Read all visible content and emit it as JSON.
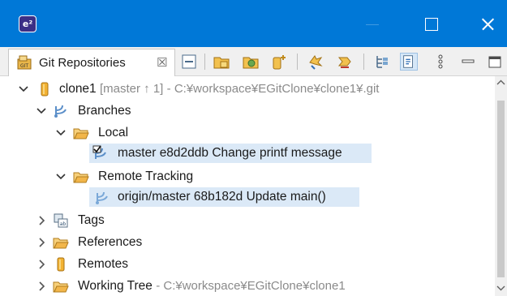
{
  "window": {
    "app_icon": "e²",
    "controls": [
      "minimize-icon",
      "maximize-icon",
      "close-icon"
    ]
  },
  "view": {
    "tab_label": "Git Repositories",
    "tab_close": "☒",
    "toolbar_icons": [
      "collapse-all-icon",
      "add-existing-repository-icon",
      "clone-repository-icon",
      "create-repository-icon",
      "fetch-icon",
      "push-icon",
      "hierarchical-branch-layout-icon",
      "link-with-selection-icon",
      "view-menu-icon",
      "minimize-view-icon",
      "maximize-view-icon"
    ]
  },
  "tree": {
    "repository": {
      "name": "clone1",
      "decoration": "[master ↑ 1]",
      "path": "- C:¥workspace¥EGitClone¥clone1¥.git"
    },
    "branches": {
      "label": "Branches",
      "local": {
        "label": "Local",
        "items": [
          {
            "name": "master",
            "commit": "e8d2ddb",
            "message": "Change printf message"
          }
        ]
      },
      "remote": {
        "label": "Remote Tracking",
        "items": [
          {
            "name": "origin/master",
            "commit": "68b182d",
            "message": "Update main()"
          }
        ]
      }
    },
    "tags": "Tags",
    "references": "References",
    "remotes": "Remotes",
    "working_tree": {
      "label": "Working Tree",
      "path": "- C:¥workspace¥EGitClone¥clone1"
    }
  },
  "colors": {
    "titlebar": "#0078d7",
    "selection": "#dbe9f7",
    "decoration_text": "#8a8a8a",
    "folder": "#e8a13c"
  }
}
